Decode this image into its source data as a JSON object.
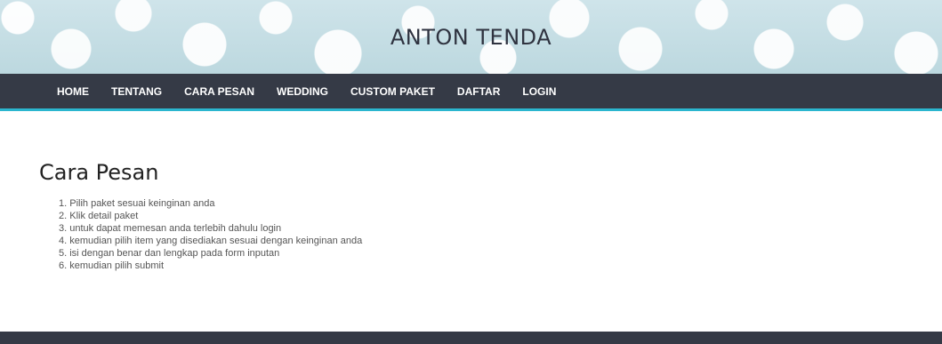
{
  "header": {
    "site_title": "ANTON TENDA"
  },
  "nav": {
    "items": [
      {
        "label": "HOME"
      },
      {
        "label": "TENTANG"
      },
      {
        "label": "CARA PESAN"
      },
      {
        "label": "WEDDING"
      },
      {
        "label": "CUSTOM PAKET"
      },
      {
        "label": "DAFTAR"
      },
      {
        "label": "LOGIN"
      }
    ]
  },
  "main": {
    "title": "Cara Pesan",
    "steps": [
      "1. Pilih paket sesuai keinginan anda",
      "2. Klik detail paket",
      "3. untuk dapat memesan anda terlebih dahulu login",
      "4. kemudian pilih item yang disediakan sesuai dengan keinginan anda",
      "5. isi dengan benar dan lengkap pada form inputan",
      "6. kemudian pilih submit"
    ]
  },
  "colors": {
    "nav_bg": "#353a46",
    "nav_accent": "#2bb6cf",
    "banner_bg": "#cfe4ea"
  }
}
